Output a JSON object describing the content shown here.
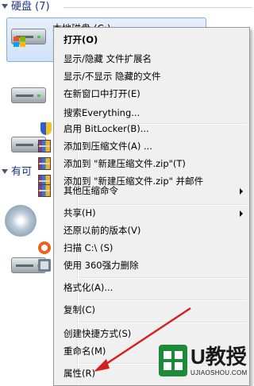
{
  "group": {
    "header_label": "硬盘 (7)",
    "header_label2": "有可"
  },
  "drive": {
    "label": "本地磁盘 (C:)"
  },
  "menu": {
    "items": [
      {
        "label": "打开(O)",
        "bold": true
      },
      {
        "label": "显示/隐藏 文件扩展名"
      },
      {
        "label": "显示/不显示 隐藏的文件"
      },
      {
        "label": "在新窗口中打开(E)"
      },
      {
        "label": "搜索Everything..."
      },
      {
        "label": "启用 BitLocker(B)...",
        "icon": "bitlocker-shield-icon"
      },
      {
        "label": "添加到压缩文件(A) ...",
        "icon": "winrar-icon"
      },
      {
        "label": "添加到 \"新建压缩文件.zip\"(T)",
        "icon": "winrar-icon"
      },
      {
        "label": "添加到 \"新建压缩文件.zip\" 并邮件",
        "icon": "winrar-icon"
      },
      {
        "label": "其他压缩命令",
        "icon": "winrar-icon",
        "submenu": true
      },
      {
        "label": "共享(H)",
        "submenu": true
      },
      {
        "label": "还原以前的版本(V)"
      },
      {
        "label": "扫描 C:\\ (S)",
        "icon": "360-scan-icon"
      },
      {
        "label": "使用 360强力删除",
        "icon": "360-delete-icon"
      },
      {
        "label": "格式化(A)..."
      },
      {
        "label": "复制(C)"
      },
      {
        "label": "创建快捷方式(S)"
      },
      {
        "label": "重命名(M)"
      },
      {
        "label": "属性(R)"
      }
    ]
  },
  "watermark": {
    "brand": "U教授",
    "url": "UJIAOSHOU.COM"
  },
  "colors": {
    "header": "#1e3287",
    "selection": "#cfe2f7",
    "annotation_arrow": "#d42020",
    "watermark_green": "#1d8a3a"
  }
}
